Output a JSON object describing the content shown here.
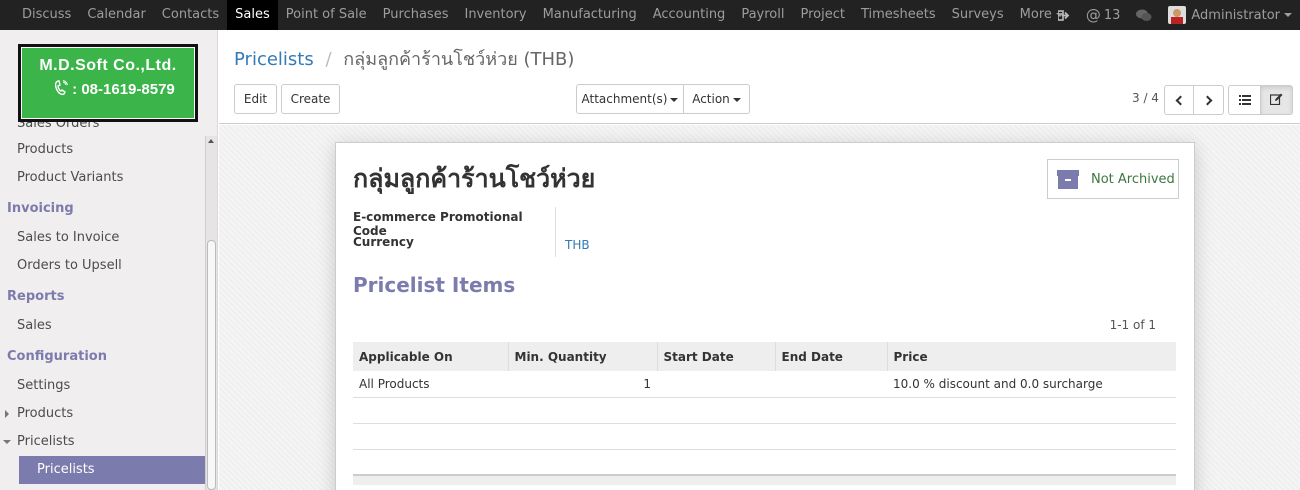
{
  "topnav": {
    "items": [
      "Discuss",
      "Calendar",
      "Contacts",
      "Sales",
      "Point of Sale",
      "Purchases",
      "Inventory",
      "Manufacturing",
      "Accounting",
      "Payroll",
      "Project",
      "Timesheets",
      "Surveys"
    ],
    "active": "Sales",
    "more_label": "More",
    "notification_count": "13",
    "user_name": "Administrator"
  },
  "logo": {
    "company": "M.D.Soft Co.,Ltd.",
    "phone": ": 08-1619-8579"
  },
  "sidebar": {
    "cut_item": "Sales Orders",
    "items_top": [
      "Products",
      "Product Variants"
    ],
    "invoicing_header": "Invoicing",
    "invoicing_items": [
      "Sales to Invoice",
      "Orders to Upsell"
    ],
    "reports_header": "Reports",
    "reports_items": [
      "Sales"
    ],
    "configuration_header": "Configuration",
    "configuration_items": [
      "Settings",
      "Products",
      "Pricelists"
    ],
    "active_subitem": "Pricelists"
  },
  "breadcrumb": {
    "parent": "Pricelists",
    "separator": "/",
    "current": "กลุ่มลูกค้าร้านโชว์ห่วย (THB)"
  },
  "toolbar": {
    "edit_label": "Edit",
    "create_label": "Create",
    "attachments_label": "Attachment(s)",
    "action_label": "Action",
    "pager": "3 / 4"
  },
  "record": {
    "title": "กลุ่มลูกค้าร้านโชว์ห่วย",
    "archive_label": "Not Archived",
    "fields": [
      {
        "label": "E-commerce Promotional Code",
        "value": ""
      },
      {
        "label": "Currency",
        "value": "THB"
      }
    ],
    "section_title": "Pricelist Items",
    "list_pager": "1-1 of 1"
  },
  "pricelist_items": {
    "columns": [
      "Applicable On",
      "Min. Quantity",
      "Start Date",
      "End Date",
      "Price"
    ],
    "rows": [
      {
        "applicable_on": "All Products",
        "min_quantity": "1",
        "start_date": "",
        "end_date": "",
        "price": "10.0 % discount and 0.0 surcharge"
      }
    ]
  }
}
